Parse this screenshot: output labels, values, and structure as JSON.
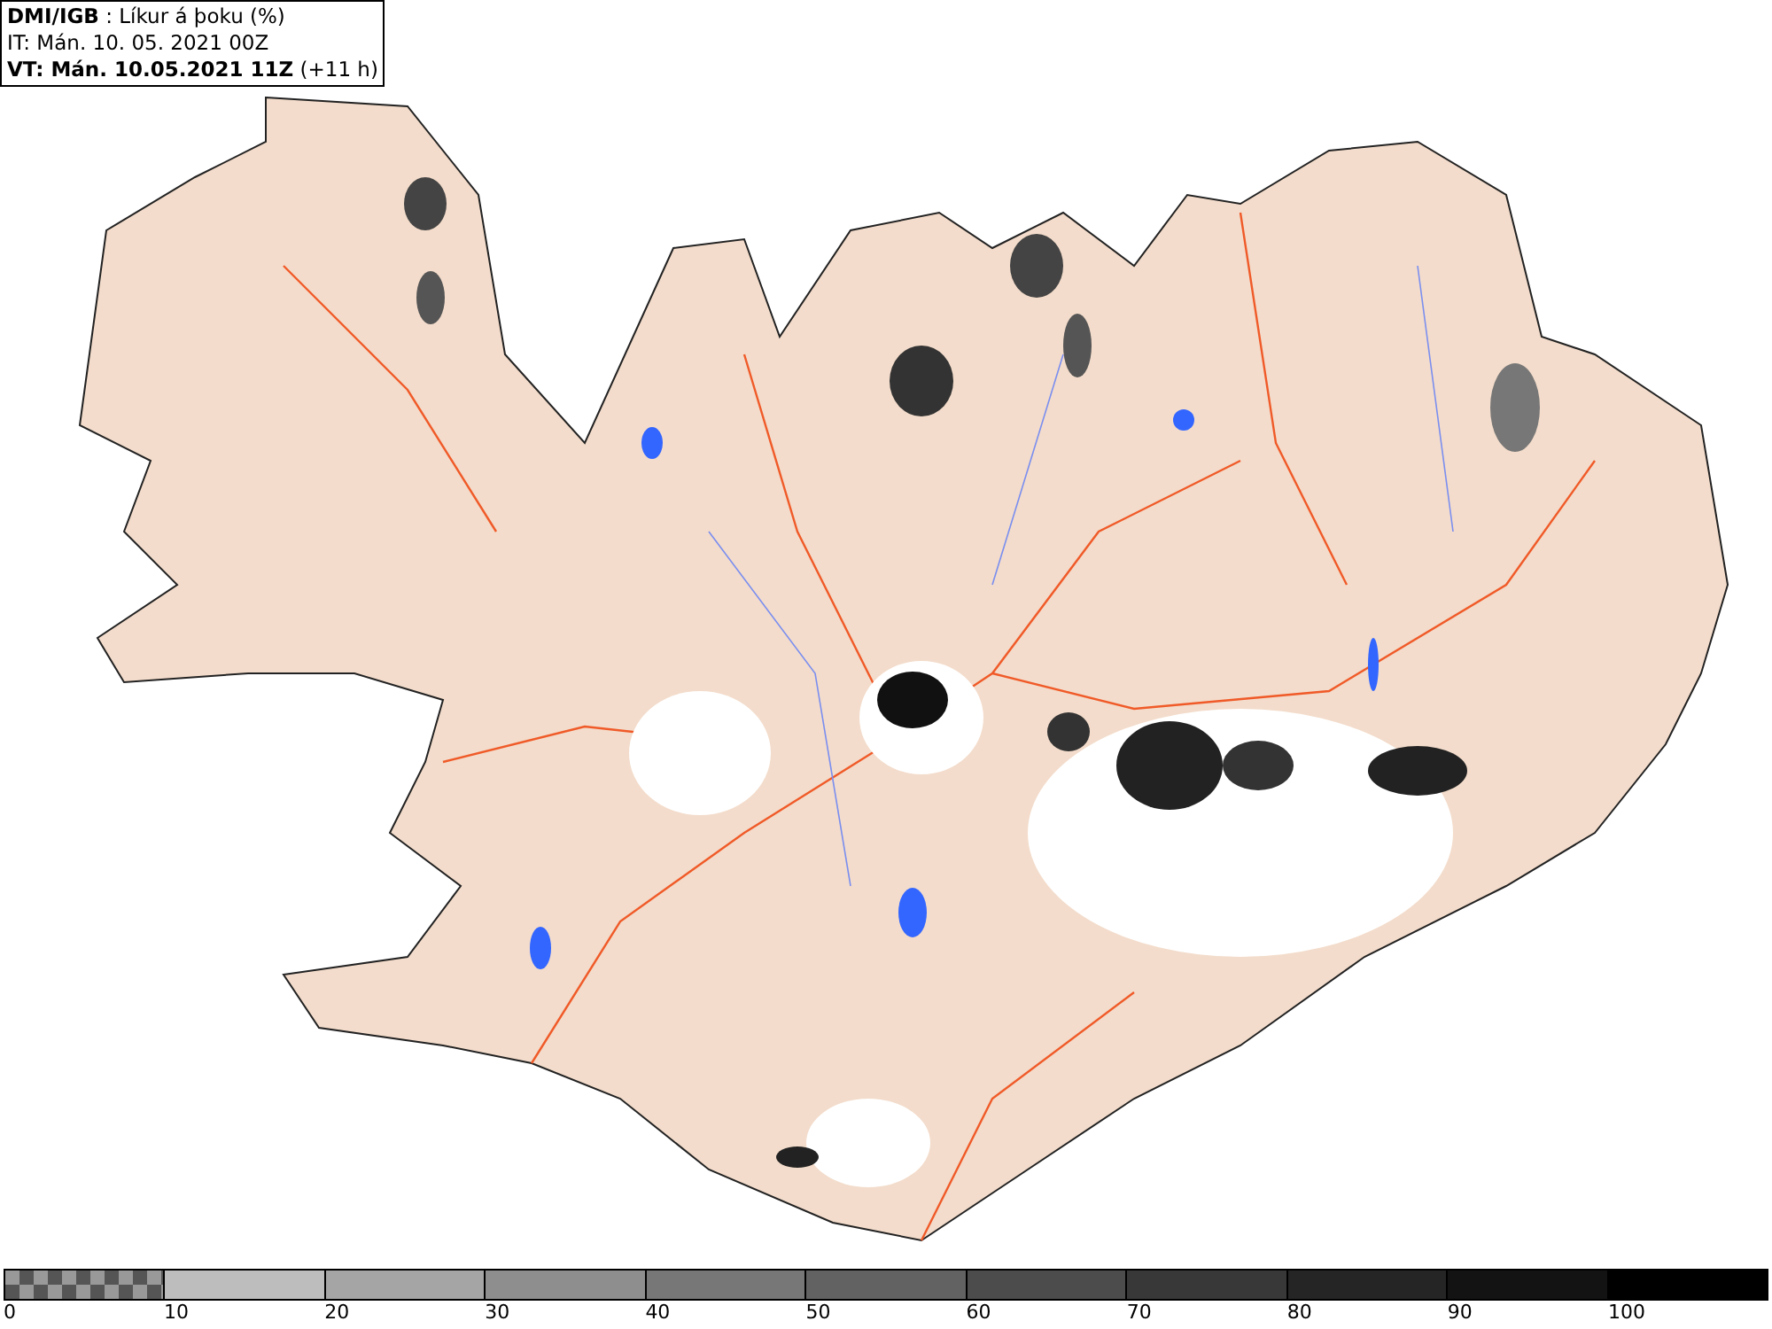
{
  "legend": {
    "lines": [
      "**DMI/IGB** : Líkur á þoku (%)",
      "IT: Mán. 10. 05. 2021 00Z",
      "**VT: Mán. 10.05.2021 11Z** (+11 h)"
    ]
  },
  "colorbar": {
    "segments": [
      {
        "kind": "checker"
      },
      {
        "kind": "solid",
        "color": "#bdbdbd"
      },
      {
        "kind": "solid",
        "color": "#a5a5a5"
      },
      {
        "kind": "solid",
        "color": "#8e8e8e"
      },
      {
        "kind": "solid",
        "color": "#777777"
      },
      {
        "kind": "solid",
        "color": "#626262"
      },
      {
        "kind": "solid",
        "color": "#4c4c4c"
      },
      {
        "kind": "solid",
        "color": "#383838"
      },
      {
        "kind": "solid",
        "color": "#252525"
      },
      {
        "kind": "solid",
        "color": "#131313"
      },
      {
        "kind": "solid",
        "color": "#000000"
      }
    ],
    "ticks": [
      "0",
      "10",
      "20",
      "30",
      "40",
      "50",
      "60",
      "70",
      "80",
      "90",
      "100"
    ]
  }
}
